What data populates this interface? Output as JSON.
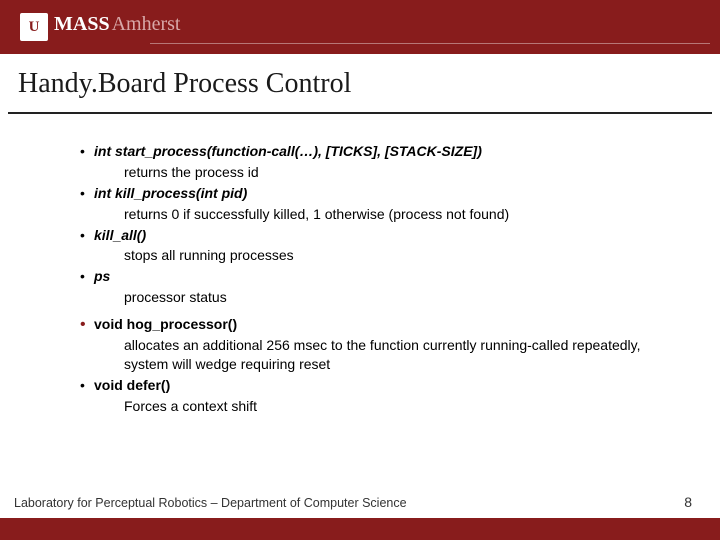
{
  "logo": {
    "icon_text": "U",
    "mass": "MASS",
    "amherst": "Amherst"
  },
  "title": "Handy.Board Process Control",
  "items": [
    {
      "sig": "int start_process(function-call(…), [TICKS], [STACK-SIZE])",
      "desc": "returns the process id",
      "red": false
    },
    {
      "sig": "int kill_process(int pid)",
      "desc": "returns 0 if successfully killed, 1 otherwise (process not found)",
      "red": false
    },
    {
      "sig": "kill_all()",
      "desc": "stops all running processes",
      "red": false
    },
    {
      "sig": "ps",
      "desc": "processor status",
      "red": false
    }
  ],
  "items2": [
    {
      "sig": "void hog_processor()",
      "desc": "allocates an additional 256 msec to the function currently running-called repeatedly, system will wedge requiring reset",
      "red": true
    },
    {
      "sig": "void defer()",
      "desc": "Forces a context shift",
      "red": false
    }
  ],
  "footer": "Laboratory for Perceptual Robotics – Department of Computer Science",
  "page_number": "8"
}
